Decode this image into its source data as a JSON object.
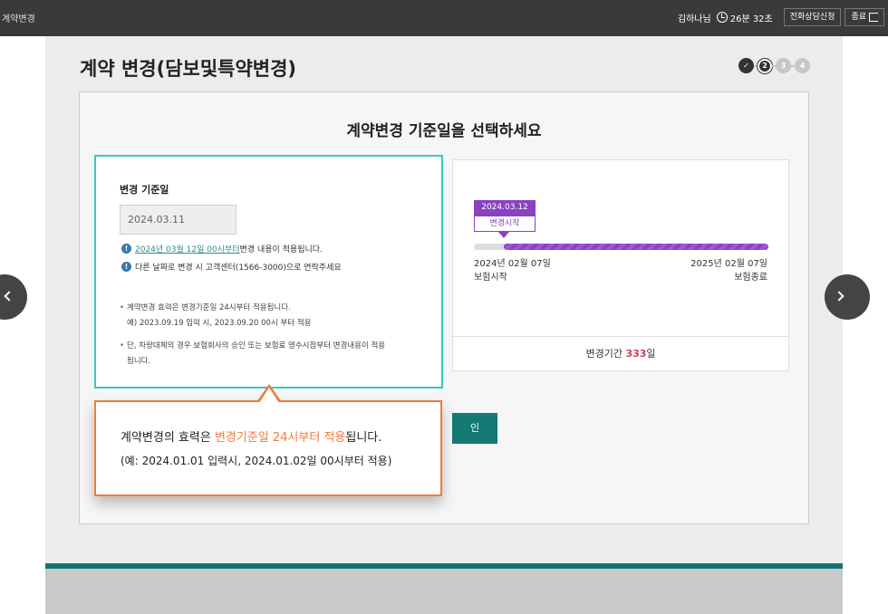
{
  "topbar": {
    "app_title": "계약변경",
    "user": "김하나님",
    "timer": "26분 32초",
    "phone_consult_label": "전화상담신청",
    "exit_label": "종료"
  },
  "page": {
    "title": "계약 변경(담보및특약변경)",
    "steps": [
      {
        "label": "",
        "state": "done"
      },
      {
        "label": "2",
        "state": "current"
      },
      {
        "label": "3",
        "state": "todo"
      },
      {
        "label": "4",
        "state": "todo"
      }
    ],
    "heading": "계약변경 기준일을 선택하세요"
  },
  "form": {
    "field_title": "변경 기준일",
    "date_value": "2024.03.11",
    "info1_highlight": "2024년 03월 12일 00시부터",
    "info1_rest": " 변경 내용이 적용됩니다.",
    "info2": "다른 날짜로 변경 시 고객센터(1566-3000)으로 연락주세요",
    "note1": "계약변경 효력은 변경기준일 24시부터 적용됩니다.",
    "note1_example": "예) 2023.09.19 입력 시, 2023.09.20 00시 부터 적용",
    "note2_line1": "단, 차량대체의 경우 보험회사의 승인 또는 보험료 영수시점부터 변경내용이 적용",
    "note2_line2": "됩니다."
  },
  "timeline": {
    "change_date": "2024.03.12",
    "change_label": "변경시작",
    "start_date": "2024년 02월 07일",
    "start_label": "보험시작",
    "end_date": "2025년 02월 07일",
    "end_label": "보험종료",
    "period_prefix": "변경기간 ",
    "period_days": "333",
    "period_suffix": "일",
    "progress_start_fraction": 0.1,
    "bar_color": "#8a42c4"
  },
  "confirm_button_label": "인",
  "callout": {
    "line1_prefix": "계약변경의 효력은 ",
    "line1_accent": "변경기준일 24시부터 적용",
    "line1_suffix": "됩니다.",
    "line2": "(예: 2024.01.01 입력시, 2024.01.02일 00시부터 적용)",
    "accent_color": "#f07b3f"
  },
  "icons": {
    "clock": "clock-icon",
    "exit": "exit-icon",
    "info": "info-icon",
    "check": "check-icon",
    "nav_prev": "chevron-left-icon",
    "nav_next": "chevron-right-icon"
  }
}
